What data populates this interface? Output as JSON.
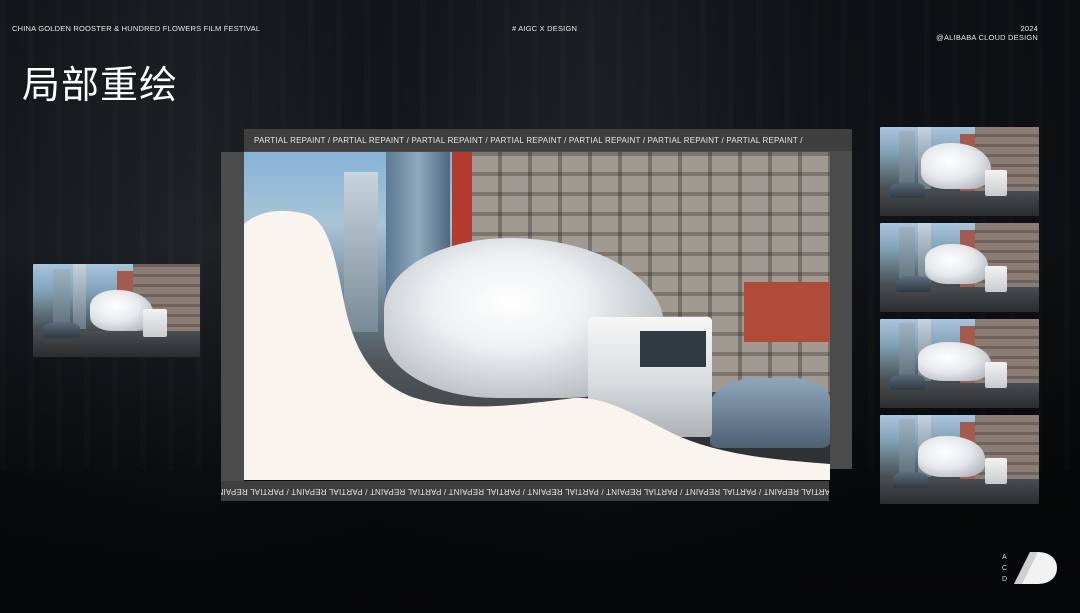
{
  "header": {
    "left": "CHINA GOLDEN ROOSTER & HUNDRED FLOWERS FILM FESTIVAL",
    "middle": "# AIGC X DESIGN",
    "year": "2024",
    "right": "@ALIBABA CLOUD DESIGN"
  },
  "title": "局部重绘",
  "main": {
    "strip_top": "PARTIAL REPAINT  /   PARTIAL REPAINT  /   PARTIAL REPAINT  /   PARTIAL REPAINT  /  PARTIAL REPAINT  /   PARTIAL REPAINT  /  PARTIAL REPAINT  /",
    "strip_bottom": "PARTIAL REPAINT  /  PARTIAL REPAINT  /  PARTIAL REPAINT  /  PARTIAL REPAINT  /  PARTIAL REPAINT  /  PARTIAL REPAINT  /  PARTIAL REPAINT  /  PARTIAL REPAINT  /"
  },
  "logo": {
    "letters": [
      "A",
      "C",
      "D"
    ]
  },
  "colors": {
    "background": "#0b0d0f",
    "strip": "#3e3e3e",
    "mask": "#faf4ee"
  }
}
